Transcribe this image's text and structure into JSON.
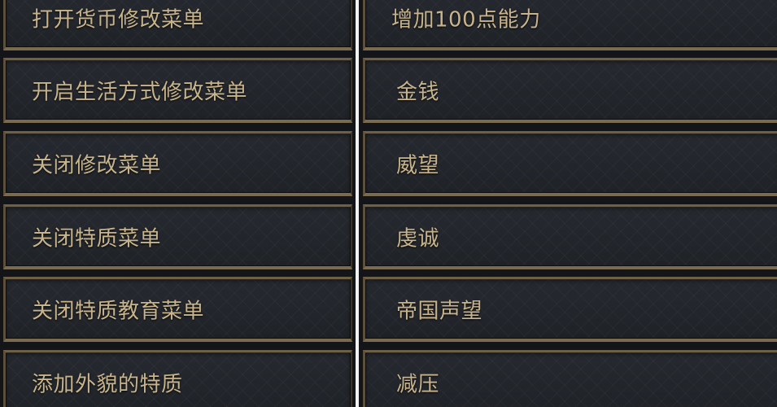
{
  "left_column": {
    "items": [
      {
        "label": "打开货币修改菜单"
      },
      {
        "label": "开启生活方式修改菜单"
      },
      {
        "label": "关闭修改菜单"
      },
      {
        "label": "关闭特质菜单"
      },
      {
        "label": "关闭特质教育菜单"
      },
      {
        "label": "添加外貌的特质"
      }
    ]
  },
  "right_column": {
    "items": [
      {
        "label": "增加100点能力"
      },
      {
        "label": "金钱"
      },
      {
        "label": "威望"
      },
      {
        "label": "虔诚"
      },
      {
        "label": "帝国声望"
      },
      {
        "label": "减压"
      }
    ]
  },
  "colors": {
    "panel_background": "#22252b",
    "frame_gold": "#7a6a4f",
    "label_text": "#c8b48c"
  }
}
